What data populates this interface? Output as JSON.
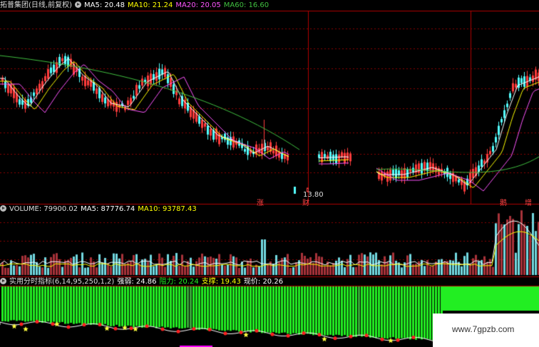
{
  "colors": {
    "up": "#ff3c3c",
    "down": "#54ffff",
    "ma5": "#ffffff",
    "ma10": "#ffff00",
    "ma20": "#ff55ff",
    "ma60": "#40c040",
    "volbar_up": "#a8323a",
    "volbar_down": "#72d8e0",
    "resist": "#22ee22",
    "grid": "#8b0000"
  },
  "price_panel": {
    "title": "拓普集团(日线,前复权)",
    "ma5": "MA5: 20.48",
    "ma10": "MA10: 21.24",
    "ma20": "MA20: 20.05",
    "ma60": "MA60: 16.60",
    "low_label": "13.80",
    "event_labels": [
      "涨",
      "财",
      "鹅",
      "增"
    ]
  },
  "volume_panel": {
    "name": "VOLUME: 79900.02",
    "ma5": "MA5: 87776.74",
    "ma10": "MA10: 93787.43"
  },
  "indicator_panel": {
    "name": "实用分时指标(6,14,95,250,1,2)",
    "strength": "强弱: 24.86",
    "resistance": "阻力: 20.24",
    "support": "支撑: 19.43",
    "current": "现价: 20.26"
  },
  "icons": {
    "settings": "settings-circle-icon",
    "star": "star-icon"
  },
  "watermark": "www.7gpzb.com"
}
